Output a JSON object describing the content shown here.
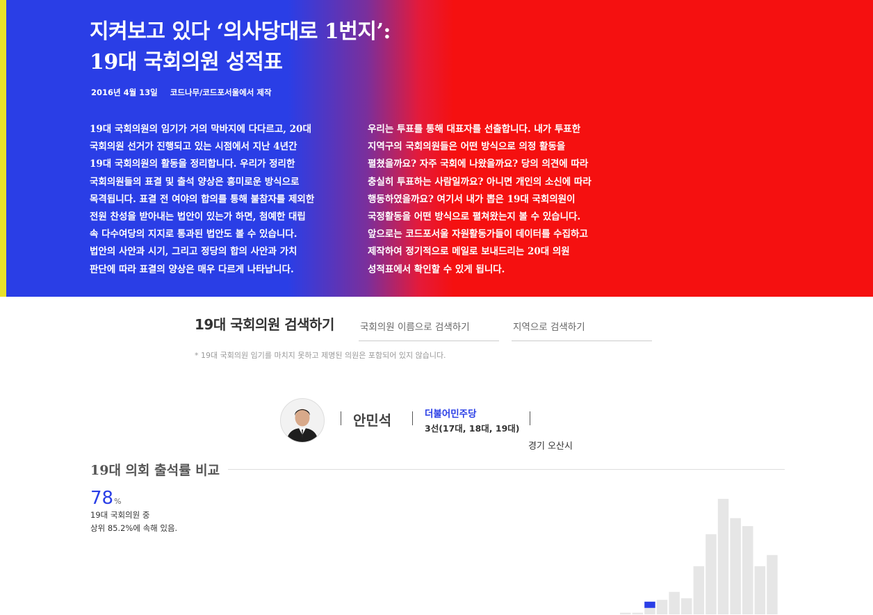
{
  "hero": {
    "title_line1": "지켜보고 있다 ‘의사당대로 1번지’:",
    "title_line2": "19대 국회의원 성적표",
    "date": "2016년 4월 13일",
    "credit": "코드나무/코드포서울에서 제작",
    "col1": [
      "19대 국회의원의 임기가 거의 막바지에 다다르고, 20대",
      "국회의원 선거가 진행되고 있는 시점에서 지난 4년간",
      "19대 국회의원의 활동을 정리합니다. 우리가 정리한",
      "국회의원들의 표결 및 출석 양상은 흥미로운 방식으로",
      "목격됩니다. 표결 전 여야의 합의를 통해 불참자를 제외한",
      "전원 찬성을 받아내는 법안이 있는가 하면, 첨예한 대립",
      "속 다수여당의 지지로 통과된 법안도 볼 수 있습니다.",
      "법안의 사안과 시기, 그리고 정당의 합의 사안과 가치",
      "판단에 따라 표결의 양상은 매우 다르게 나타납니다."
    ],
    "col2": [
      "우리는 투표를 통해 대표자를 선출합니다. 내가 투표한",
      "지역구의 국회의원들은 어떤 방식으로 의정 활동을",
      "펼쳤을까요? 자주 국회에 나왔을까요? 당의 의견에 따라",
      "충실히 투표하는 사람일까요? 아니면 개인의 소신에 따라",
      "행동하였을까요? 여기서 내가 뽑은 19대 국회의원이",
      "국정활동을 어떤 방식으로 펼쳐왔는지 볼 수 있습니다.",
      "앞으로는 코드포서울 자원활동가들이 데이터를 수집하고",
      "제작하여 정기적으로 메일로 보내드리는 20대 의원",
      "성적표에서 확인할 수 있게 됩니다."
    ],
    "colors": {
      "blue": "#2a3ee6",
      "red": "#f51010",
      "stripe": "#e8e12a"
    }
  },
  "search": {
    "title": "19대 국회의원 검색하기",
    "name_placeholder": "국회의원 이름으로 검색하기",
    "region_placeholder": "지역으로 검색하기",
    "note": "* 19대 국회의원 임기를 마치지 못하고 제명된 의원은 포함되어 있지 않습니다."
  },
  "profile": {
    "name": "안민석",
    "party": "더불어민주당",
    "terms": "3선(17대, 18대, 19대)",
    "region": "경기 오산시",
    "avatar": "avatar-photo"
  },
  "attendance": {
    "title": "19대 의회 출석률 비교",
    "value": "78",
    "unit": "%",
    "desc_line1": "19대 국회의원 중",
    "desc_line2": "상위 85.2%에 속해 있음.",
    "highlight_color": "#2a3ee6",
    "bar_color": "#e6e6e6"
  },
  "chart_data": {
    "type": "bar",
    "title": "19대 의회 출석률 비교",
    "values": [
      1,
      1,
      4,
      9,
      14,
      10,
      30,
      50,
      72,
      60,
      55,
      30,
      37
    ],
    "highlight_index": 2,
    "ylim": [
      0,
      75
    ],
    "grid": false
  }
}
